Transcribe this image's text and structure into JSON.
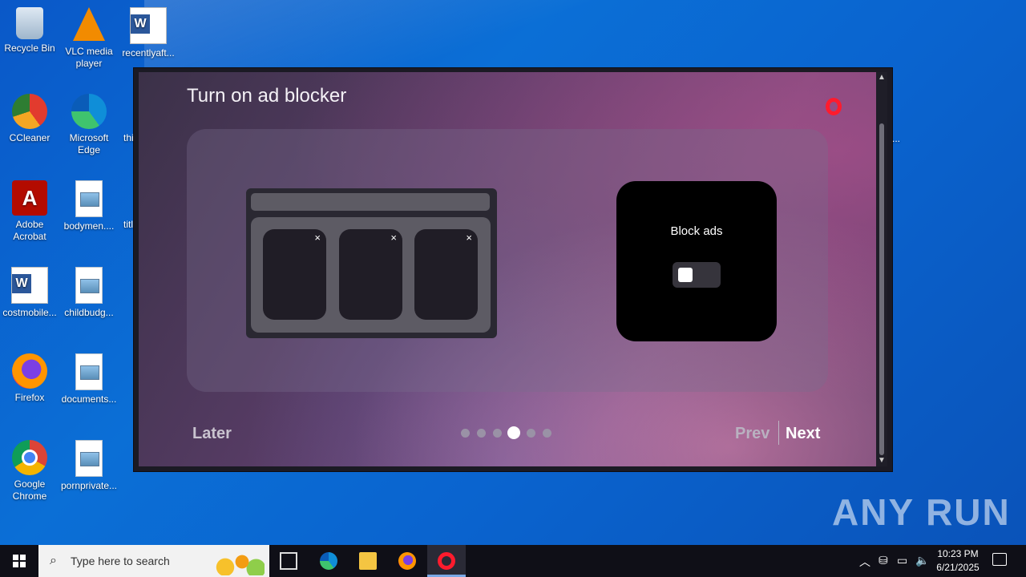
{
  "desktop": {
    "icons": [
      {
        "label": "Recycle Bin"
      },
      {
        "label": "VLC media player"
      },
      {
        "label": "recentlyaft..."
      },
      {
        "label": "CCleaner"
      },
      {
        "label": "Microsoft Edge"
      },
      {
        "label": "thi"
      },
      {
        "label": "Adobe Acrobat"
      },
      {
        "label": "bodymen...."
      },
      {
        "label": "titl"
      },
      {
        "label": "costmobile..."
      },
      {
        "label": "childbudg..."
      },
      {
        "label": "Firefox"
      },
      {
        "label": "documents..."
      },
      {
        "label": "Google Chrome"
      },
      {
        "label": "pornprivate..."
      }
    ],
    "partial_label_right": "..."
  },
  "onboarding": {
    "title": "Turn on ad blocker",
    "block_ads_label": "Block ads",
    "toggle_on": false,
    "later_label": "Later",
    "prev_label": "Prev",
    "next_label": "Next",
    "step_current": 4,
    "step_total": 6,
    "ad_close_glyph": "×"
  },
  "taskbar": {
    "search_placeholder": "Type here to search",
    "pinned": [
      "task-view",
      "microsoft-edge",
      "file-explorer",
      "firefox",
      "opera"
    ],
    "active": "opera",
    "time": "10:23 PM",
    "date": "6/21/2025"
  },
  "watermark": {
    "text": "ANY RUN"
  }
}
